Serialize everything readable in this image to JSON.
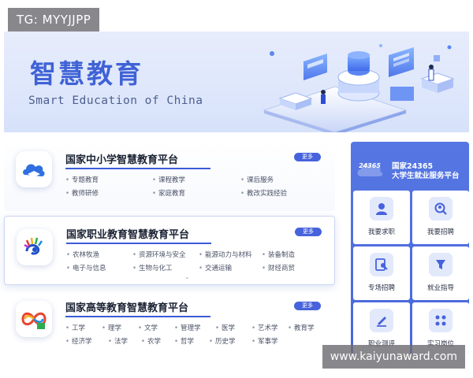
{
  "watermarks": {
    "top_left": "TG: MYYJJPP",
    "bottom_right": "www.kaiyunaward.com"
  },
  "banner": {
    "title": "智慧教育",
    "subtitle": "Smart Education of China"
  },
  "platforms": [
    {
      "title": "国家中小学智慧教育平台",
      "more_label": "更多",
      "tags": [
        "专题教育",
        "课程教学",
        "课后服务",
        "教师研修",
        "家庭教育",
        "教改实践经验"
      ]
    },
    {
      "title": "国家职业教育智慧教育平台",
      "more_label": "更多",
      "tags": [
        "农林牧渔",
        "资源环境与安全",
        "能源动力与材料",
        "装备制造",
        "电子与信息",
        "生物与化工",
        "交通运输",
        "财经商贸"
      ]
    },
    {
      "title": "国家高等教育智慧教育平台",
      "more_label": "更多",
      "tags": [
        "工学",
        "理学",
        "文学",
        "管理学",
        "医学",
        "艺术学",
        "教育学",
        "经济学",
        "法学",
        "农学",
        "哲学",
        "历史学",
        "军事学"
      ]
    }
  ],
  "employment": {
    "badge": "24365",
    "title_line1": "国家24365",
    "title_line2": "大学生就业服务平台",
    "tiles": [
      {
        "label": "我要求职",
        "icon": "person-icon"
      },
      {
        "label": "我要招聘",
        "icon": "search-person-icon"
      },
      {
        "label": "专场招聘",
        "icon": "document-search-icon"
      },
      {
        "label": "就业指导",
        "icon": "guide-icon"
      },
      {
        "label": "职业测评",
        "icon": "pen-icon"
      },
      {
        "label": "实习岗位",
        "icon": "grid-dots-icon"
      }
    ]
  },
  "colors": {
    "accent": "#4662dc",
    "panel": "#4d6ddd",
    "banner_title": "#3f62d6"
  }
}
